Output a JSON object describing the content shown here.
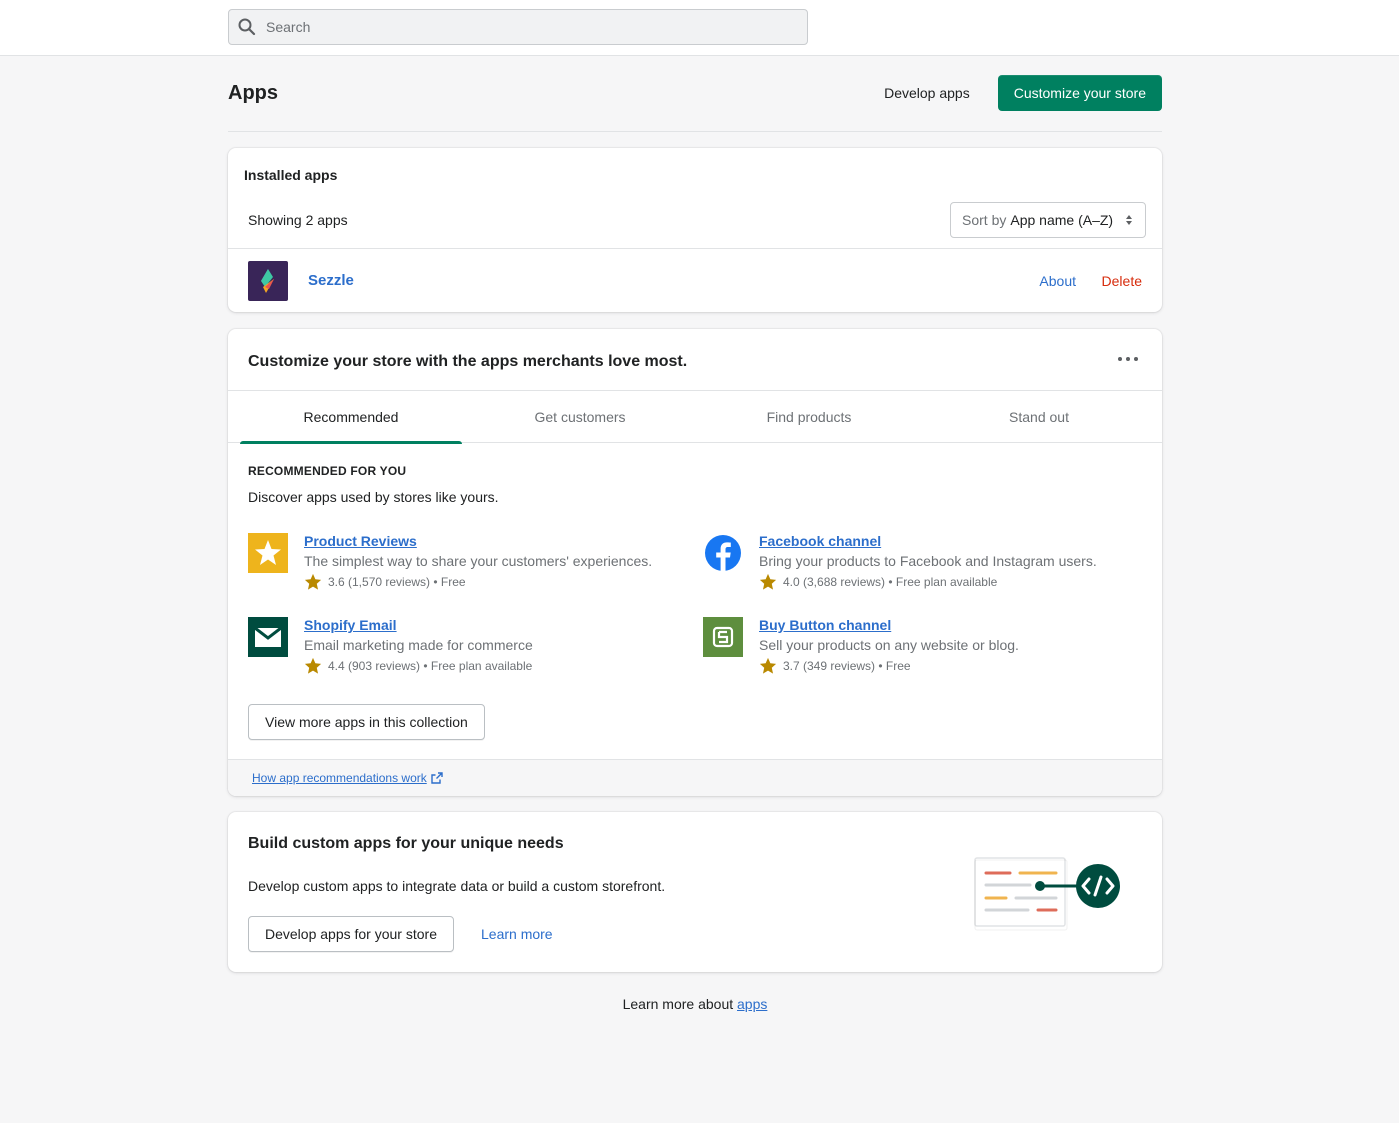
{
  "search": {
    "placeholder": "Search"
  },
  "header": {
    "title": "Apps",
    "develop_apps_label": "Develop apps",
    "customize_label": "Customize your store"
  },
  "installed": {
    "title": "Installed apps",
    "showing": "Showing 2 apps",
    "sort_prefix": "Sort by",
    "sort_value": "App name (A–Z)",
    "apps": [
      {
        "name": "Sezzle",
        "about": "About",
        "delete": "Delete"
      }
    ]
  },
  "recommend": {
    "title": "Customize your store with the apps merchants love most.",
    "tabs": [
      "Recommended",
      "Get customers",
      "Find products",
      "Stand out"
    ],
    "section_heading": "RECOMMENDED FOR YOU",
    "section_sub": "Discover apps used by stores like yours.",
    "items": [
      {
        "name": "Product Reviews",
        "desc": "The simplest way to share your customers' experiences.",
        "meta": "3.6 (1,570 reviews) • Free",
        "icon": "star-icon",
        "icon_bg": "#eeb41c"
      },
      {
        "name": "Facebook channel",
        "desc": "Bring your products to Facebook and Instagram users.",
        "meta": "4.0 (3,688 reviews) • Free plan available",
        "icon": "facebook-icon",
        "icon_bg": "#1877f2"
      },
      {
        "name": "Shopify Email",
        "desc": "Email marketing made for commerce",
        "meta": "4.4 (903 reviews) • Free plan available",
        "icon": "envelope-icon",
        "icon_bg": "#004c3f"
      },
      {
        "name": "Buy Button channel",
        "desc": "Sell your products on any website or blog.",
        "meta": "3.7 (349 reviews) • Free",
        "icon": "buy-button-icon",
        "icon_bg": "#5e8e3e"
      }
    ],
    "view_more_label": "View more apps in this collection",
    "footer_link": "How app recommendations work"
  },
  "custom": {
    "title": "Build custom apps for your unique needs",
    "text": "Develop custom apps to integrate data or build a custom storefront.",
    "develop_button": "Develop apps for your store",
    "learn_more": "Learn more"
  },
  "bottom": {
    "prefix": "Learn more about ",
    "link": "apps"
  },
  "colors": {
    "primary": "#008060",
    "link": "#2c6ecb",
    "critical": "#d72c0d",
    "star": "#b98900"
  }
}
